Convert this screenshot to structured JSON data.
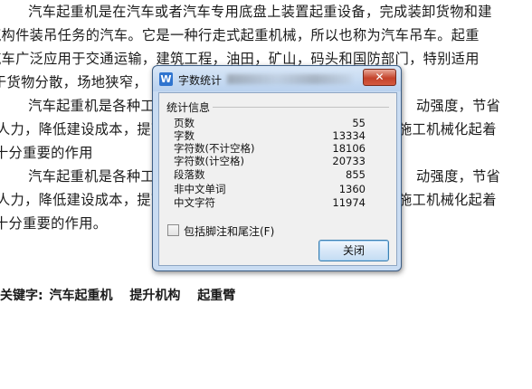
{
  "document": {
    "lines": [
      "　　汽车起重机是在汽车或者汽车专用底盘上装置起重设备，完成装卸货物和建",
      "筑构件装吊任务的汽车。它是一种行走式起重机械，所以也称为汽车吊车。起重",
      "汽车广泛应用于交通运输，建筑工程，油田，矿山，码头和国防部门，特别适用",
      "于货物分散，场地狭窄，",
      "　　汽车起重机是各种工程",
      "人力，降低建设成本，提高",
      "十分重要的作用",
      "　　汽车起重机是各种工程",
      "人力，降低建设成本，提高",
      "十分重要的作用。"
    ],
    "right_fragments": [
      "动强度，节省",
      "施工机械化起着",
      "动强度，节省",
      "施工机械化起着"
    ],
    "keywords_label": "关键字:",
    "keywords": [
      "汽车起重机",
      "提升机构",
      "起重臂"
    ]
  },
  "dialog": {
    "title": "字数统计",
    "app_icon_letter": "W",
    "close_symbol": "✕",
    "group_label": "统计信息",
    "stats": [
      {
        "label": "页数",
        "value": "55"
      },
      {
        "label": "字数",
        "value": "13334"
      },
      {
        "label": "字符数(不计空格)",
        "value": "18106"
      },
      {
        "label": "字符数(计空格)",
        "value": "20733"
      },
      {
        "label": "段落数",
        "value": "855"
      },
      {
        "label": "非中文单词",
        "value": "1360"
      },
      {
        "label": "中文字符",
        "value": "11974"
      }
    ],
    "checkbox_label": "包括脚注和尾注(F)",
    "checkbox_checked": false,
    "close_button_label": "关闭"
  }
}
